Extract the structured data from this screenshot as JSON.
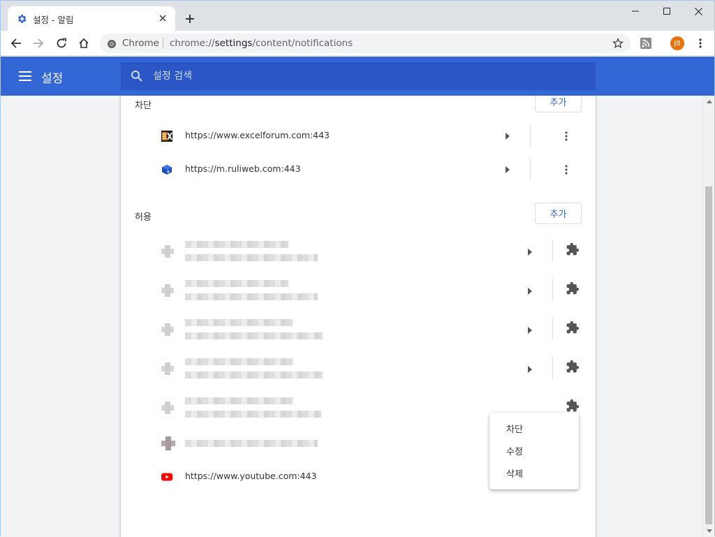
{
  "window": {
    "tab_title": "설정 - 알림",
    "controls": [
      "minimize-icon",
      "maximize-icon",
      "close-icon"
    ]
  },
  "toolbar": {
    "scheme_label": "Chrome",
    "url_prefix": "chrome://",
    "url_host": "settings",
    "url_path": "/content/notifications",
    "avatar_initials": "JB"
  },
  "header": {
    "title": "설정",
    "search_placeholder": "설정 검색"
  },
  "sections": {
    "block": {
      "label": "차단",
      "add_label": "추가",
      "sites": [
        {
          "url": "https://www.excelforum.com:443",
          "icon": "excelforum-favicon"
        },
        {
          "url": "https://m.ruliweb.com:443",
          "icon": "ruliweb-favicon"
        }
      ]
    },
    "allow": {
      "label": "허용",
      "add_label": "추가",
      "last_site": {
        "url": "https://www.youtube.com:443",
        "icon": "youtube-favicon"
      }
    }
  },
  "context_menu": {
    "items": [
      "차단",
      "수정",
      "삭제"
    ]
  },
  "colors": {
    "accent": "#3367d6",
    "header_search": "#2a56c6",
    "youtube_red": "#ff0000",
    "avatar": "#e8710a"
  }
}
